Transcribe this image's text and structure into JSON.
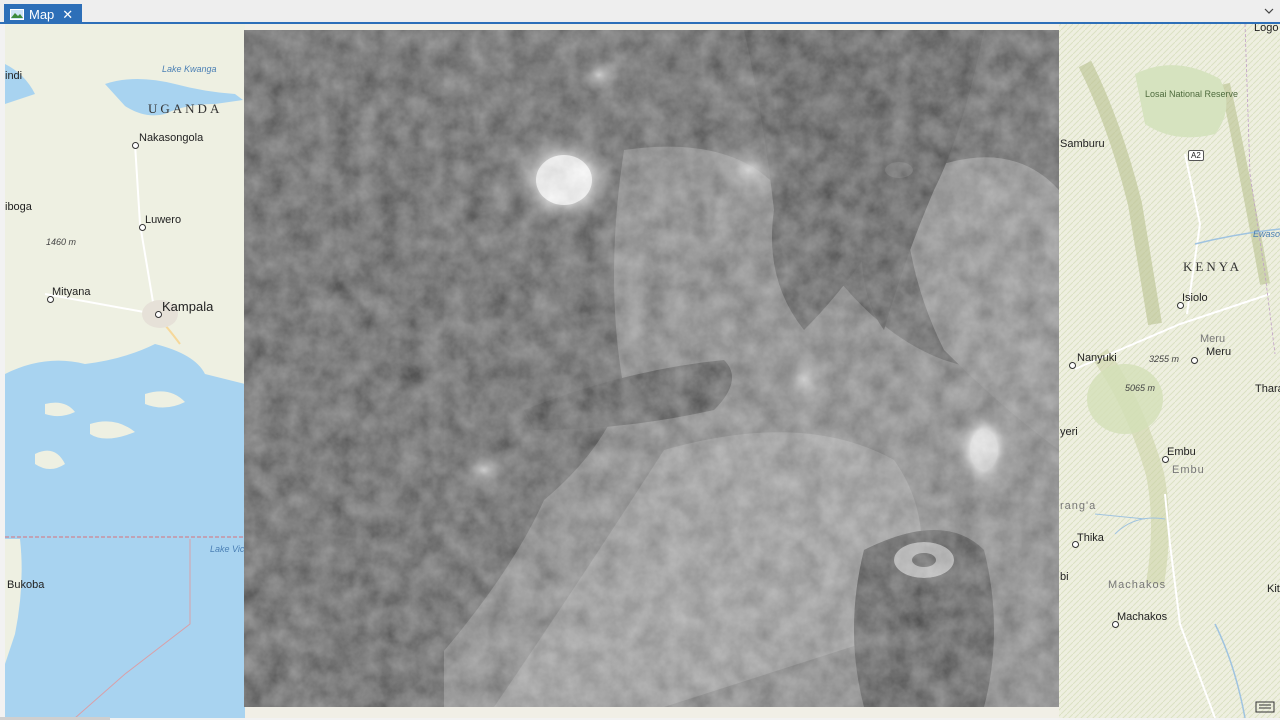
{
  "tab": {
    "label": "Map",
    "close": "✕"
  },
  "map": {
    "countries": [
      "UGANDA",
      "KENYA"
    ],
    "water_labels": [
      "Lake Kwanga",
      "Lake Victoria",
      "Victoria",
      "Ewaso"
    ],
    "places": {
      "kampala": "Kampala",
      "nakasongola": "Nakasongola",
      "luwero": "Luwero",
      "mityana": "Mityana",
      "bukoba": "Bukoba",
      "indi": "indi",
      "iboga": "iboga",
      "samburu": "Samburu",
      "isiolo": "Isiolo",
      "nanyuki": "Nanyuki",
      "meru": "Meru",
      "meru2": "Meru",
      "embu": "Embu",
      "embu2": "Embu",
      "thika": "Thika",
      "machakos": "Machakos",
      "machakos2": "Machakos",
      "yeri": "yeri",
      "ranga": "rang'a",
      "bi": "bi",
      "thar": "Thara",
      "kit": "Kit",
      "logo": "Logo",
      "reserve": "Losai National Reserve"
    },
    "elevations": [
      "1460 m",
      "3255 m",
      "5065 m"
    ],
    "road_shields": [
      "A2"
    ],
    "raster_description": "grayscale elevation raster"
  }
}
